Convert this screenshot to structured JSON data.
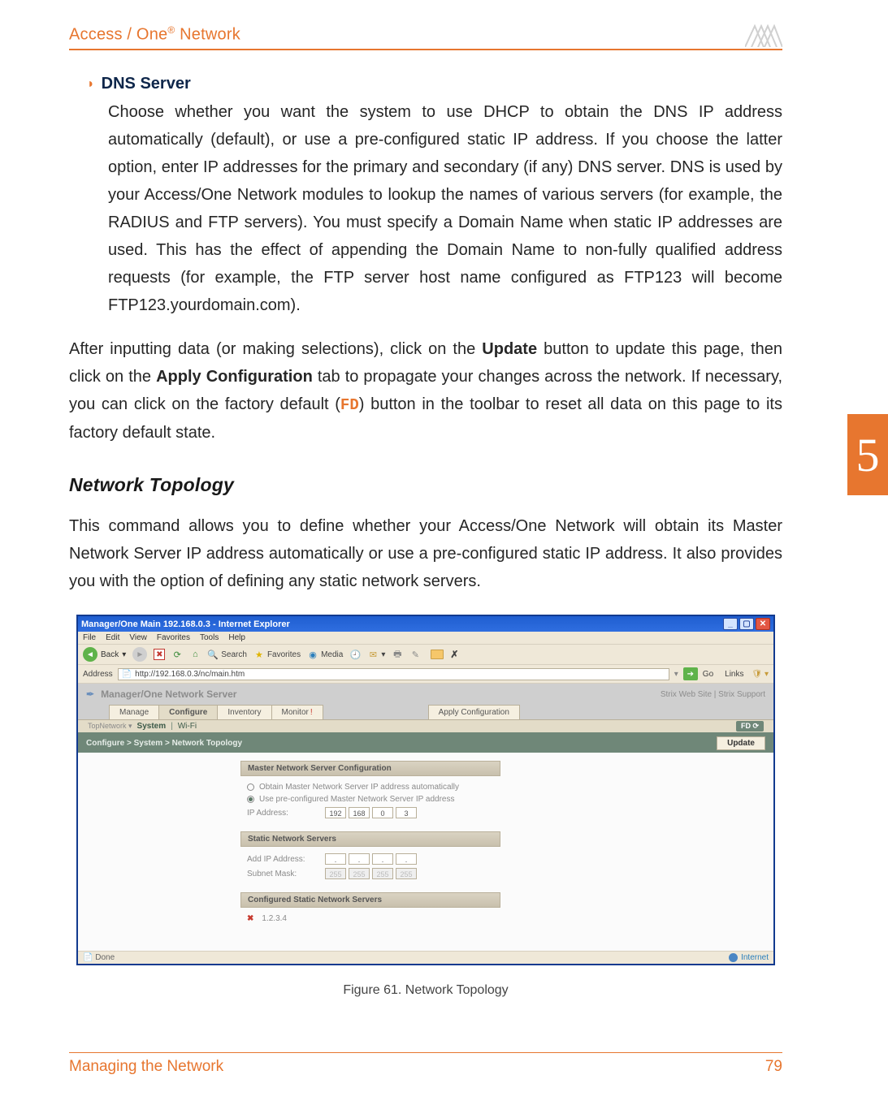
{
  "header": {
    "product_name_a": "Access / One",
    "product_name_sup": "®",
    "product_name_b": " Network"
  },
  "bullet": {
    "title": "DNS Server",
    "text": "Choose whether you want the system to use DHCP to obtain the DNS IP address automatically (default), or use a pre-configured static IP address. If you choose the latter option, enter IP addresses for the primary and secondary (if any) DNS server. DNS is used by your Access/One Network modules to lookup the names of various servers (for example, the RADIUS and FTP servers). You must specify a Domain Name when static IP addresses are used. This has the effect of appending the Domain Name to non-fully qualified address requests (for example, the FTP server host name configured as FTP123 will become FTP123.yourdomain.com)."
  },
  "para_after": {
    "t1": "After inputting data (or making selections), click on the ",
    "b1": "Update",
    "t2": " button to update this page, then click on the ",
    "b2": "Apply Configuration",
    "t3": " tab to propagate your changes across the network. If necessary, you can click on the factory default (",
    "fd": "FD",
    "t4": ") button in the toolbar to reset all data on this page to its factory default state."
  },
  "section": {
    "heading": "Network Topology",
    "para": "This command allows you to define whether your Access/One Network will obtain its Master Network Server IP address automatically or use a pre-configured static IP address. It also provides you with the option of defining any static network servers."
  },
  "chapter_number": "5",
  "ie": {
    "title": "Manager/One Main 192.168.0.3 - Internet Explorer",
    "menu": [
      "File",
      "Edit",
      "View",
      "Favorites",
      "Tools",
      "Help"
    ],
    "toolbar": {
      "back": "Back",
      "search": "Search",
      "favorites": "Favorites",
      "media": "Media"
    },
    "address_label": "Address",
    "url": "http://192.168.0.3/nc/main.htm",
    "go": "Go",
    "links": "Links"
  },
  "app": {
    "brand": "Manager/One Network Server",
    "links": "Strix Web Site  |  Strix Support",
    "tabs": {
      "manage": "Manage",
      "configure": "Configure",
      "inventory": "Inventory",
      "monitor": "Monitor",
      "apply": "Apply Configuration"
    },
    "subnav": {
      "a": "System",
      "b": "Wi-Fi"
    },
    "fd": "FD",
    "breadcrumb": "Configure > System > Network Topology",
    "update": "Update",
    "panels": {
      "master": {
        "title": "Master Network Server Configuration",
        "r1": "Obtain Master Network Server IP address automatically",
        "r2": "Use pre-configured Master Network Server IP address",
        "ip_label": "IP Address:",
        "ip": [
          "192",
          "168",
          "0",
          "3"
        ]
      },
      "static": {
        "title": "Static Network Servers",
        "add_label": "Add IP Address:",
        "add": [
          ".",
          ".",
          ".",
          "."
        ],
        "mask_label": "Subnet Mask:",
        "mask": [
          "255",
          "255",
          "255",
          "255"
        ]
      },
      "configured": {
        "title": "Configured Static Network Servers",
        "entry": "1.2.3.4"
      }
    },
    "status_done": "Done",
    "status_internet": "Internet"
  },
  "figure_caption": "Figure 61. Network Topology",
  "footer": {
    "left": "Managing the Network",
    "right": "79"
  }
}
